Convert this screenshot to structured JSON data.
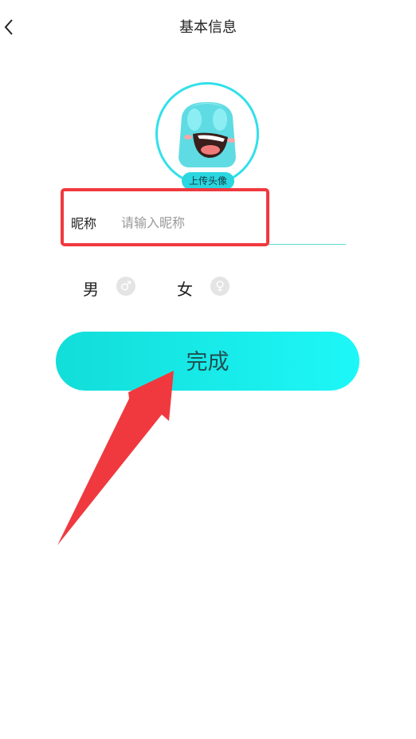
{
  "header": {
    "title": "基本信息",
    "back_icon": "chevron-left-icon"
  },
  "avatar": {
    "upload_label": "上传头像",
    "ring_color": "#31e0ea"
  },
  "nickname": {
    "label": "昵称",
    "placeholder": "请输入昵称",
    "value": ""
  },
  "gender": {
    "male_label": "男",
    "male_icon": "male-symbol-icon",
    "female_label": "女",
    "female_icon": "female-symbol-icon"
  },
  "actions": {
    "done_label": "完成"
  },
  "colors": {
    "accent": "#1ae6e6",
    "highlight": "#f0393f"
  }
}
